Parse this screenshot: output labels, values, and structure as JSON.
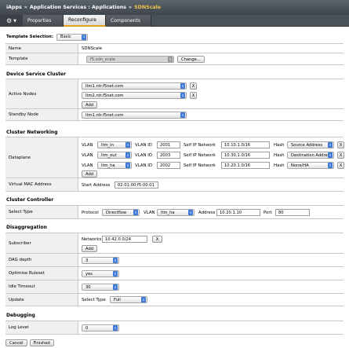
{
  "breadcrumb": {
    "root": "iApps",
    "sep": "»",
    "middle": "Application Services : Applications",
    "current": "SDNScale"
  },
  "tabs": [
    {
      "label": "Properties"
    },
    {
      "label": "Reconfigure"
    },
    {
      "label": "Components"
    }
  ],
  "template_selection": {
    "label": "Template Selection:",
    "value": "Basic"
  },
  "general": {
    "name_label": "Name",
    "name_value": "SDNScale",
    "template_label": "Template",
    "template_value": "f5.sdn_scale",
    "change_button": "Change..."
  },
  "device_service_cluster": {
    "title": "Device Service Cluster",
    "active_nodes_label": "Active Nodes",
    "active_nodes": [
      "ltm1.ntr.f5net.com",
      "ltm2.ntr.f5net.com"
    ],
    "add_label": "Add",
    "remove_label": "X",
    "standby_label": "Standby Node",
    "standby_value": "ltm1.ntr.f5net.com"
  },
  "cluster_networking": {
    "title": "Cluster Networking",
    "dataplane_label": "Dataplane",
    "col_vlan": "VLAN",
    "col_vlan_id": "VLAN ID",
    "col_self_ip": "Self IP Network",
    "col_hash": "Hash",
    "rows": [
      {
        "vlan": "ltm_in",
        "vlan_id": "2001",
        "self_ip": "10.10.1.0/16",
        "hash": "Source Address"
      },
      {
        "vlan": "ltm_out",
        "vlan_id": "2003",
        "self_ip": "10.30.1.0/16",
        "hash": "Destination Addre"
      },
      {
        "vlan": "ltm_ha",
        "vlan_id": "2002",
        "self_ip": "10.20.1.0/16",
        "hash": "None/HA"
      }
    ],
    "add_label": "Add",
    "remove_label": "X",
    "virtual_mac_label": "Virtual MAC Address",
    "start_address_label": "Start Address",
    "start_address_value": "02:01:00:f5:00:01"
  },
  "cluster_controller": {
    "title": "Cluster Controller",
    "select_type_label": "Select Type",
    "protocol_label": "Protocol",
    "protocol_value": "Directflow",
    "vlan_label": "VLAN",
    "vlan_value": "ltm_ha",
    "address_label": "Address",
    "address_value": "10.20.1.10",
    "port_label": "Port",
    "port_value": "80"
  },
  "disaggregation": {
    "title": "Disaggregation",
    "subscriber_label": "Subscriber",
    "networks_label": "Networks",
    "networks_value": "10.42.0.0/24",
    "remove_label": "X",
    "add_label": "Add",
    "dag_depth_label": "DAG depth",
    "dag_depth_value": "3",
    "optimise_label": "Optimise Ruleset",
    "optimise_value": "yes",
    "idle_label": "Idle Timeout",
    "idle_value": "30",
    "update_label": "Update",
    "update_select_label": "Select Type",
    "update_value": "Full"
  },
  "debugging": {
    "title": "Debugging",
    "log_level_label": "Log Level",
    "log_level_value": "0"
  },
  "footer": {
    "cancel": "Cancel",
    "finished": "Finished"
  },
  "colors": {
    "header": "#4a5157",
    "accent": "#e3a21a",
    "select_arrow": "#3d7bd6",
    "label_bg": "#f0f0f0"
  },
  "icons": {
    "gear": "gear-icon",
    "select_arrow": "chevron-updown-icon"
  }
}
